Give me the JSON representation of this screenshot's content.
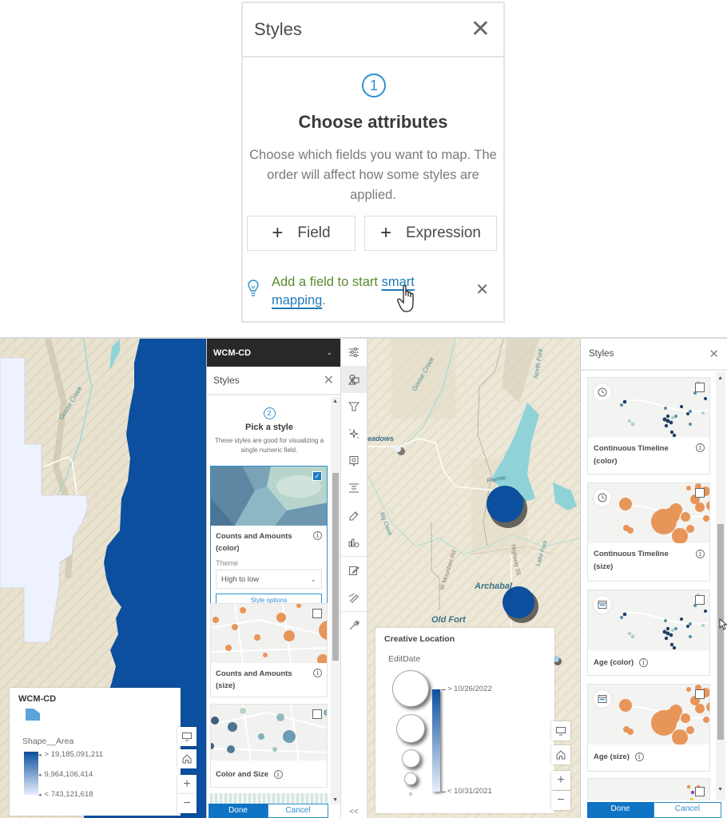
{
  "top_panel": {
    "title": "Styles",
    "step_number": "1",
    "step_title": "Choose attributes",
    "step_description": "Choose which fields you want to map. The order will affect how some styles are applied.",
    "buttons": [
      {
        "icon": "plus-icon",
        "label": "Field"
      },
      {
        "icon": "plus-icon",
        "label": "Expression"
      }
    ],
    "tip": {
      "icon": "lightbulb-icon",
      "text_before": "Add a field to start ",
      "link_text": "smart mapping",
      "text_after": "."
    }
  },
  "left_map": {
    "legend": {
      "layer_title": "WCM-CD",
      "field": "Shape__Area",
      "values": [
        "> 19,185,091,211",
        "9,964,106,414",
        "< 743,121,618"
      ]
    },
    "labels": [
      "Goose Creek"
    ],
    "controls": [
      "screen-icon",
      "home-icon",
      "zoom-in-icon",
      "zoom-out-icon"
    ]
  },
  "styles_panel_1": {
    "layer_name": "WCM-CD",
    "title": "Styles",
    "step_number": "2",
    "step_title": "Pick a style",
    "step_description": "These styles are good for visualizing a single numeric field.",
    "cards": [
      {
        "label": "Counts and Amounts (color)",
        "selected": true,
        "theme_label": "Theme",
        "theme_value": "High to low",
        "style_options_label": "Style options"
      },
      {
        "label": "Counts and Amounts (size)",
        "selected": false
      },
      {
        "label": "Color and Size",
        "selected": false
      }
    ],
    "done_label": "Done",
    "cancel_label": "Cancel",
    "collapse_label": "<<"
  },
  "action_bar": {
    "items": [
      "properties-icon",
      "styles-icon",
      "filter-icon",
      "effects-icon",
      "popups-icon",
      "fields-icon",
      "labels-icon",
      "configure-clustering-icon",
      "edit-icon",
      "sketch-icon",
      "tools-icon"
    ],
    "active": "styles-icon"
  },
  "right_map": {
    "labels": [
      "Goose Creek",
      "North Fork",
      "eadows",
      "Payette Lake",
      "Big Creek",
      "W Mountain Rd",
      "Highway 55",
      "Lake Fork",
      "Archabal",
      "Old Fort"
    ],
    "legend": {
      "layer_title": "Creative Location",
      "field": "EditDate",
      "max_label": "> 10/26/2022",
      "min_label": "< 10/31/2021"
    },
    "controls": [
      "screen-icon",
      "home-icon",
      "zoom-in-icon",
      "zoom-out-icon"
    ]
  },
  "styles_panel_2": {
    "title": "Styles",
    "cards": [
      {
        "label": "Continuous Timeline (color)",
        "badge": "clock-icon",
        "selected": false
      },
      {
        "label": "Continuous Timeline (size)",
        "badge": "clock-icon",
        "selected": false
      },
      {
        "label": "Age (color)",
        "badge": "calendar-icon",
        "selected": false
      },
      {
        "label": "Age (size)",
        "badge": "calendar-icon",
        "selected": false
      }
    ],
    "done_label": "Done",
    "cancel_label": "Cancel"
  },
  "colors": {
    "accent": "#2e8fce",
    "button_blue": "#0f74c4",
    "map_dark_blue": "#0b4f9e",
    "map_light": "#eef2ff",
    "orange_symbol": "#e8955a",
    "tip_green": "#5b8a2e"
  }
}
